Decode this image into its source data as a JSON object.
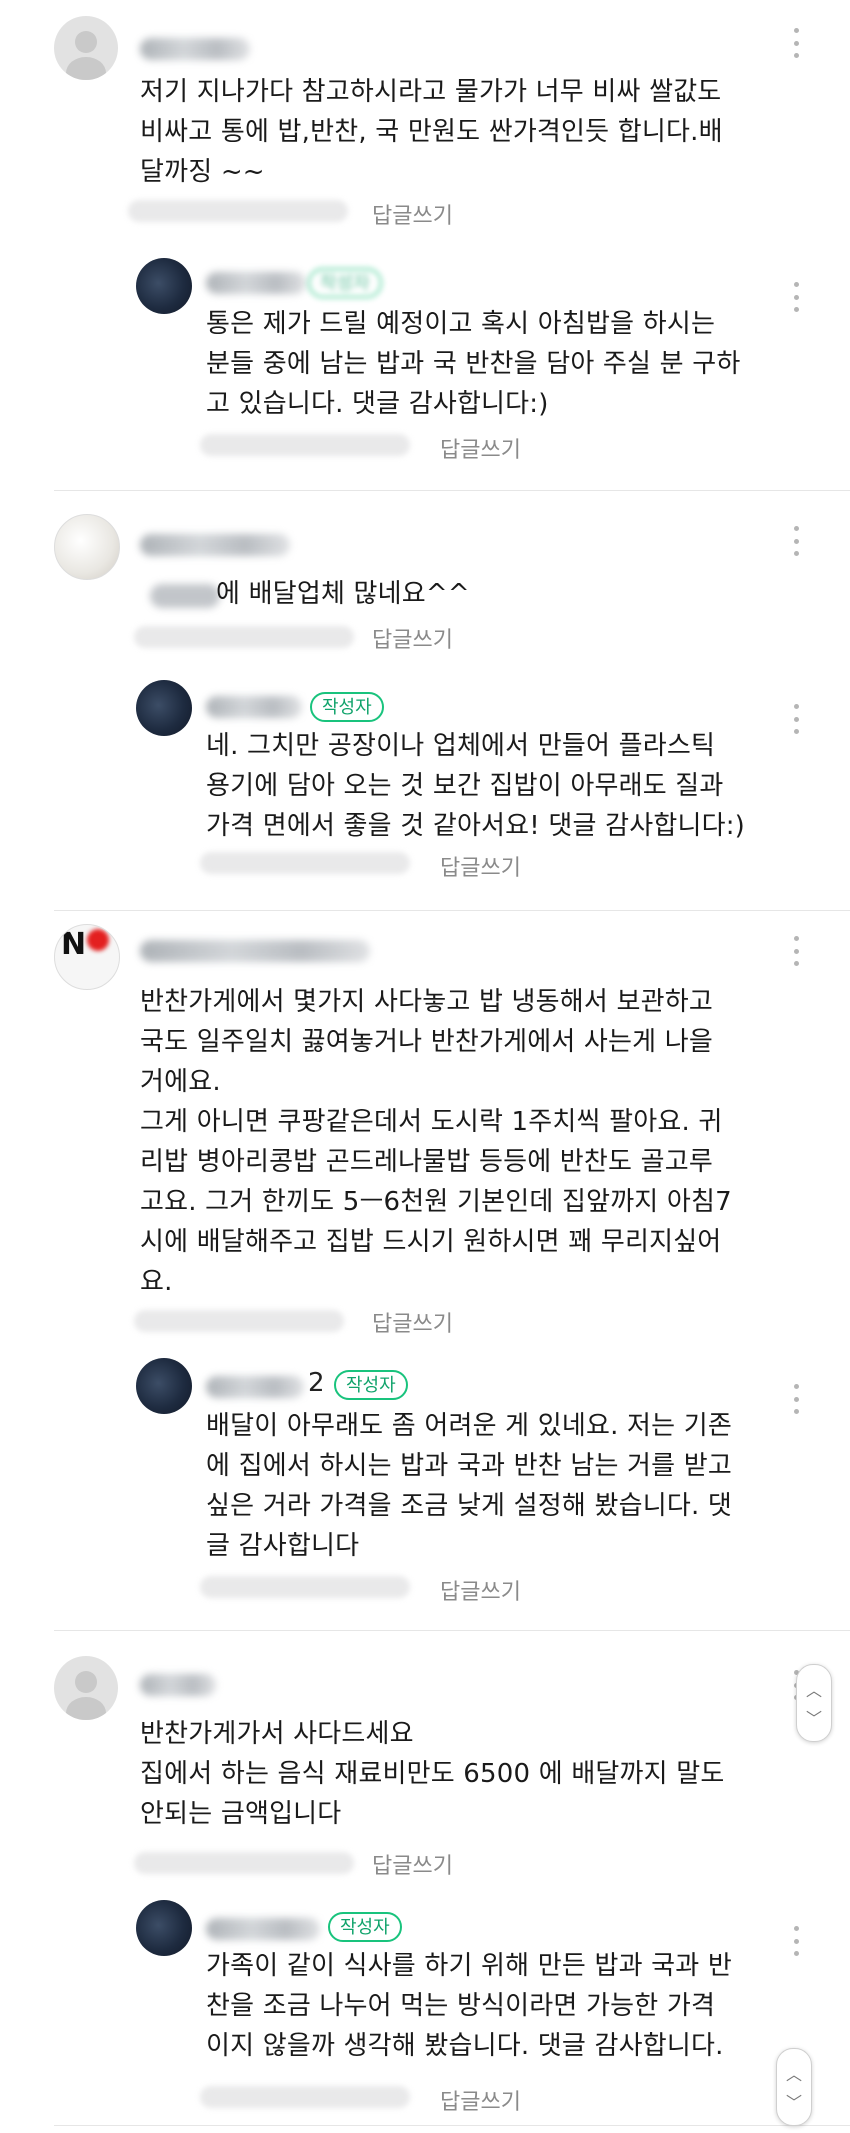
{
  "comments": [
    {
      "text": "저기 지나가다 참고하시라고 물가가 너무 비싸 쌀값도\n비싸고 통에 밥,반찬, 국 만원도 싼가격인듯 합니다.배\n달까징 ~~",
      "reply_label": "답글쓰기",
      "reply": {
        "text": "통은 제가 드릴 예정이고 혹시 아침밥을 하시는\n분들 중에 남는 밥과 국 반찬을 담아 주실 분 구하\n고 있습니다. 댓글 감사합니다:)",
        "badge": "작성자",
        "reply_label": "답글쓰기"
      }
    },
    {
      "text": "에 배달업체 많네요^^",
      "reply_label": "답글쓰기",
      "reply": {
        "text": "네. 그치만 공장이나 업체에서 만들어 플라스틱\n용기에 담아 오는 것 보간 집밥이 아무래도 질과\n가격 면에서 좋을 것 같아서요! 댓글 감사합니다:)",
        "badge": "작성자",
        "reply_label": "답글쓰기"
      }
    },
    {
      "text": "반찬가게에서 몇가지 사다놓고 밥 냉동해서 보관하고\n국도 일주일치 끓여놓거나 반찬가게에서 사는게 나을\n거에요.\n그게 아니면 쿠팡같은데서 도시락 1주치씩 팔아요. 귀\n리밥 병아리콩밥 곤드레나물밥 등등에 반찬도 골고루\n고요. 그거 한끼도 5ㅡ6천원 기본인데 집앞까지 아침7\n시에 배달해주고 집밥 드시기 원하시면 꽤 무리지싶어\n요.",
      "reply_label": "답글쓰기",
      "reply": {
        "name_suffix": "2",
        "text": "배달이 아무래도 좀 어려운 게 있네요. 저는 기존\n에 집에서 하시는 밥과 국과 반찬 남는 거를 받고\n싶은 거라 가격을 조금 낮게 설정해 봤습니다. 댓\n글 감사합니다",
        "badge": "작성자",
        "reply_label": "답글쓰기"
      }
    },
    {
      "text": "반찬가게가서 사다드세요\n집에서 하는 음식 재료비만도 6500 에 배달까지 말도\n안되는 금액입니다",
      "reply_label": "답글쓰기",
      "reply": {
        "text": "가족이 같이 식사를 하기 위해 만든 밥과 국과 반\n찬을 조금 나누어 먹는 방식이라면 가능한 가격\n이지 않을까 생각해 봤습니다. 댓글 감사합니다.",
        "badge": "작성자",
        "reply_label": "답글쓰기"
      }
    }
  ],
  "scroll_arrows": {
    "up": "︿",
    "down": "﹀"
  }
}
